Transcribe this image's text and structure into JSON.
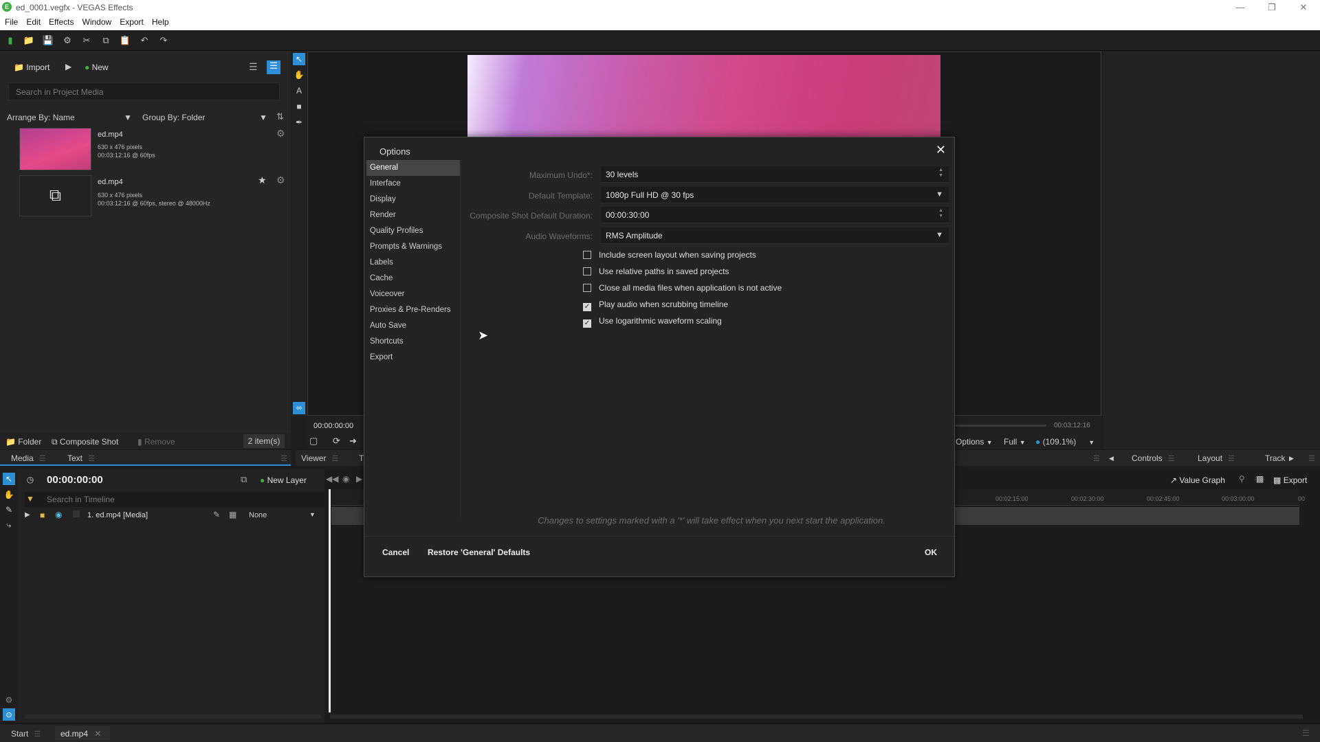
{
  "window": {
    "title": "ed_0001.vegfx - VEGAS Effects",
    "app_icon": "E"
  },
  "menu": [
    "File",
    "Edit",
    "Effects",
    "Window",
    "Export",
    "Help"
  ],
  "media": {
    "import_label": "Import",
    "new_label": "New",
    "search_placeholder": "Search in Project Media",
    "arrange_label": "Arrange By: Name",
    "group_label": "Group By: Folder",
    "items": [
      {
        "name": "ed.mp4",
        "line1": "630 x 476 pixels",
        "line2": "00:03:12:16 @ 60fps"
      },
      {
        "name": "ed.mp4",
        "line1": "630 x 476 pixels",
        "line2": "00:03:12:16 @ 60fps, stereo @ 48000Hz"
      }
    ],
    "folder_label": "Folder",
    "composite_label": "Composite Shot",
    "remove_label": "Remove",
    "count_label": "2 item(s)"
  },
  "tabs": {
    "media": "Media",
    "text": "Text",
    "viewer": "Viewer",
    "t": "T",
    "controls": "Controls",
    "layout": "Layout",
    "track": "Track"
  },
  "viewer": {
    "time_start": "00:00:00:00",
    "time_end": "00:03:12:16",
    "options_label": "Options",
    "quality_label": "Full",
    "zoom_label": "(109.1%)"
  },
  "timeline": {
    "time": "00:00:00:00",
    "new_layer_label": "New Layer",
    "search_placeholder": "Search in Timeline",
    "layer_name": "1. ed.mp4 [Media]",
    "blend_label": "None",
    "value_graph_label": "Value Graph",
    "export_label": "Export",
    "ruler": [
      "00:02:15:00",
      "00:02:30:00",
      "00:02:45:00",
      "00:03:00:00",
      "00"
    ]
  },
  "bottom_tabs": {
    "start": "Start",
    "doc": "ed.mp4"
  },
  "dialog": {
    "title": "Options",
    "nav": [
      "General",
      "Interface",
      "Display",
      "Render",
      "Quality Profiles",
      "Prompts & Warnings",
      "Labels",
      "Cache",
      "Voiceover",
      "Proxies & Pre-Renders",
      "Auto Save",
      "Shortcuts",
      "Export"
    ],
    "selected_nav": "General",
    "fields": {
      "max_undo_label": "Maximum Undo*:",
      "max_undo_value": "30 levels",
      "template_label": "Default Template:",
      "template_value": "1080p Full HD @ 30 fps",
      "composite_label": "Composite Shot Default Duration:",
      "composite_value": "00:00:30:00",
      "waveform_label": "Audio Waveforms:",
      "waveform_value": "RMS Amplitude"
    },
    "checkboxes": [
      {
        "label": "Include screen layout when saving projects",
        "checked": false
      },
      {
        "label": "Use relative paths in saved projects",
        "checked": false
      },
      {
        "label": "Close all media files when application is not active",
        "checked": false
      },
      {
        "label": "Play audio when scrubbing timeline",
        "checked": true
      },
      {
        "label": "Use logarithmic waveform scaling",
        "checked": true
      }
    ],
    "note": "Changes to settings marked with a '*' will take effect when you next start the application.",
    "cancel_label": "Cancel",
    "restore_label": "Restore 'General' Defaults",
    "ok_label": "OK"
  },
  "colors": {
    "accent_blue": "#2d8fd5",
    "brand_green": "#3cb043",
    "selection": "#454545"
  }
}
